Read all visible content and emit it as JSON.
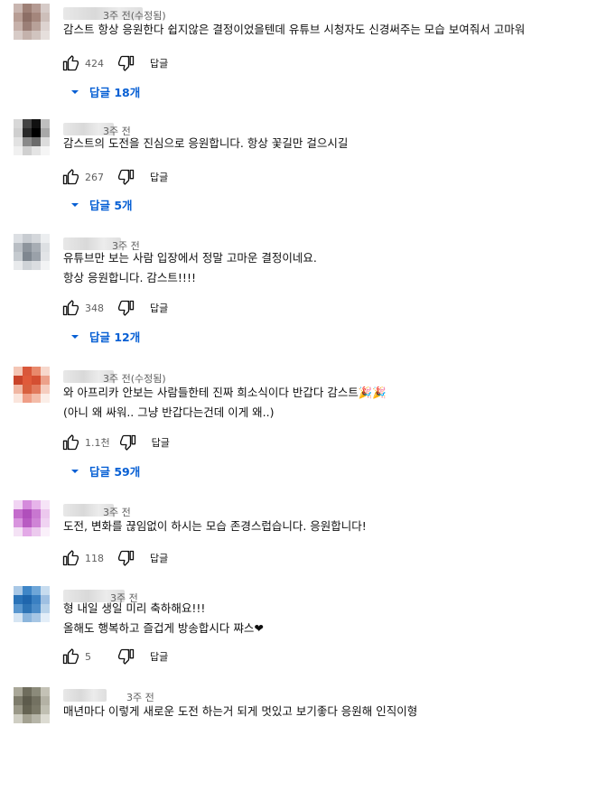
{
  "comments": [
    {
      "time": "3주 전(수정됨)",
      "lines": [
        "감스트 항상 응원한다 쉽지않은 결정이었을텐데 유튜브 시청자도 신경써주는 모습 보여줘서 고마워"
      ],
      "likes": "424",
      "reply_label": "답글",
      "replies_label": "답글 18개",
      "avatar_colors": [
        "#c9b6b0",
        "#9e8076",
        "#b49a92",
        "#d6cbc8",
        "#b89e95",
        "#8d6f66",
        "#a4867c",
        "#cdbfba",
        "#c6b1aa",
        "#9b7f77",
        "#b8a199",
        "#ddd3d0",
        "#d7cbc7",
        "#c4b2ac",
        "#d1c4bf",
        "#e6dfdc"
      ]
    },
    {
      "time": "3주 전",
      "lines": [
        "감스트의 도전을 진심으로 응원합니다. 항상 꽃길만 걸으시길"
      ],
      "likes": "267",
      "reply_label": "답글",
      "replies_label": "답글 5개",
      "avatar_colors": [
        "#d8d8d8",
        "#444444",
        "#111111",
        "#bfbfbf",
        "#cfcfcf",
        "#2a2a2a",
        "#000000",
        "#a8a8a8",
        "#e2e2e2",
        "#8a8a8a",
        "#6b6b6b",
        "#dcdcdc",
        "#f0f0f0",
        "#d0d0d0",
        "#e4e4e4",
        "#f5f5f5"
      ]
    },
    {
      "time": "3주 전",
      "lines": [
        "유튜브만 보는 사람 입장에서 정말 고마운 결정이네요.",
        "항상 응원합니다. 감스트!!!!"
      ],
      "likes": "348",
      "reply_label": "답글",
      "replies_label": "답글 12개",
      "avatar_colors": [
        "#dcdfe3",
        "#c8ccd1",
        "#d4d7db",
        "#eceef0",
        "#b9bec4",
        "#8e959d",
        "#a7adb4",
        "#dde0e3",
        "#c5cacf",
        "#7f8790",
        "#9aa1a9",
        "#e2e4e7",
        "#e8eaec",
        "#cfd3d7",
        "#dadde0",
        "#f2f3f4"
      ]
    },
    {
      "time": "3주 전(수정됨)",
      "lines": [
        "와 아프리카 안보는 사람들한테 진짜 희소식이다 반갑다 감스트🎉🎉",
        "(아니 왜 싸워.. 그냥 반갑다는건데 이게 왜..)"
      ],
      "likes": "1.1천",
      "reply_label": "답글",
      "replies_label": "답글 59개",
      "avatar_colors": [
        "#f4c6b5",
        "#d9573a",
        "#e8896c",
        "#f7d8cc",
        "#c9442a",
        "#e05a3a",
        "#d44f32",
        "#eca18a",
        "#f0b7a3",
        "#d8603f",
        "#e27a5d",
        "#f5cdbf",
        "#fae5dc",
        "#ef9e87",
        "#f3bca9",
        "#fbeee8"
      ]
    },
    {
      "time": "3주 전",
      "lines": [
        "도전, 변화를 끊임없이 하시는 모습 존경스럽습니다. 응원합니다!"
      ],
      "likes": "118",
      "reply_label": "답글",
      "replies_label": "",
      "avatar_colors": [
        "#f1d4f3",
        "#d58bdc",
        "#e7b4ea",
        "#f6e4f7",
        "#c46ccc",
        "#b04fbb",
        "#c877d0",
        "#ecc8ee",
        "#d894de",
        "#b85bc2",
        "#cf84d6",
        "#f0d3f2",
        "#f4e2f5",
        "#e3a9e7",
        "#eccaee",
        "#faf0fa"
      ]
    },
    {
      "time": "3주 전",
      "lines": [
        "형 내일 생일 미리 축하해요!!!",
        "올해도 행복하고 즐겁게 방송합시다 쨔스❤"
      ],
      "likes": "5",
      "reply_label": "답글",
      "replies_label": "",
      "avatar_colors": [
        "#a9c8e6",
        "#3f86c7",
        "#6ea6d8",
        "#c7dcef",
        "#2a73b8",
        "#1f66ad",
        "#3a80c2",
        "#9fc0e2",
        "#5a97cf",
        "#2e74b5",
        "#4c8cc8",
        "#b9d3ea",
        "#d6e5f3",
        "#8bb5dc",
        "#a7c6e4",
        "#e3eef8"
      ]
    },
    {
      "time": "3주 전",
      "lines": [
        "매년마다 이렇게 새로운 도전 하는거 되게 멋있고 보기좋다 응원해 인직이형"
      ],
      "likes": "",
      "reply_label": "",
      "replies_label": "",
      "avatar_colors": [
        "#a9a798",
        "#6f6d5d",
        "#8b8a7a",
        "#c4c2b6",
        "#7e7c6c",
        "#5d5b4c",
        "#737161",
        "#b4b2a5",
        "#9a9888",
        "#656352",
        "#7a7867",
        "#c0bfb2",
        "#cfcec3",
        "#a3a191",
        "#b6b5a8",
        "#dcdbd2"
      ]
    }
  ]
}
